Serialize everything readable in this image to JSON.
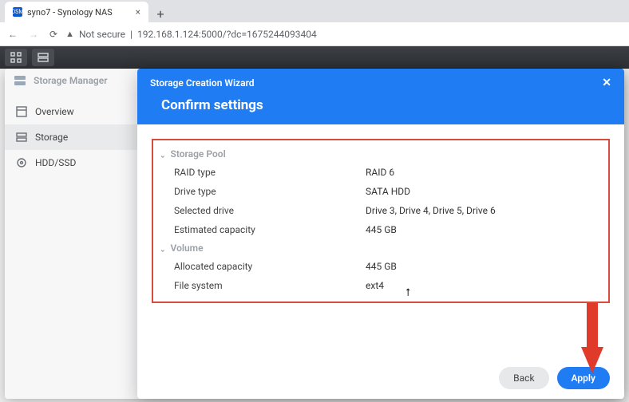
{
  "browser": {
    "tab_title": "syno7 - Synology NAS",
    "security_label": "Not secure",
    "url": "192.168.1.124:5000/?dc=1675244093404"
  },
  "storage_manager": {
    "title": "Storage Manager",
    "side": {
      "overview": "Overview",
      "storage": "Storage",
      "hddssd": "HDD/SSD"
    }
  },
  "wizard": {
    "header_small": "Storage Creation Wizard",
    "header_big": "Confirm settings",
    "sections": {
      "pool": {
        "title": "Storage Pool",
        "raid_type_k": "RAID type",
        "raid_type_v": "RAID 6",
        "drive_type_k": "Drive type",
        "drive_type_v": "SATA HDD",
        "sel_drive_k": "Selected drive",
        "sel_drive_v": "Drive 3, Drive 4, Drive 5, Drive 6",
        "est_cap_k": "Estimated capacity",
        "est_cap_v": "445 GB"
      },
      "volume": {
        "title": "Volume",
        "alloc_k": "Allocated capacity",
        "alloc_v": "445 GB",
        "fs_k": "File system",
        "fs_v": "ext4"
      }
    },
    "buttons": {
      "back": "Back",
      "apply": "Apply"
    }
  }
}
